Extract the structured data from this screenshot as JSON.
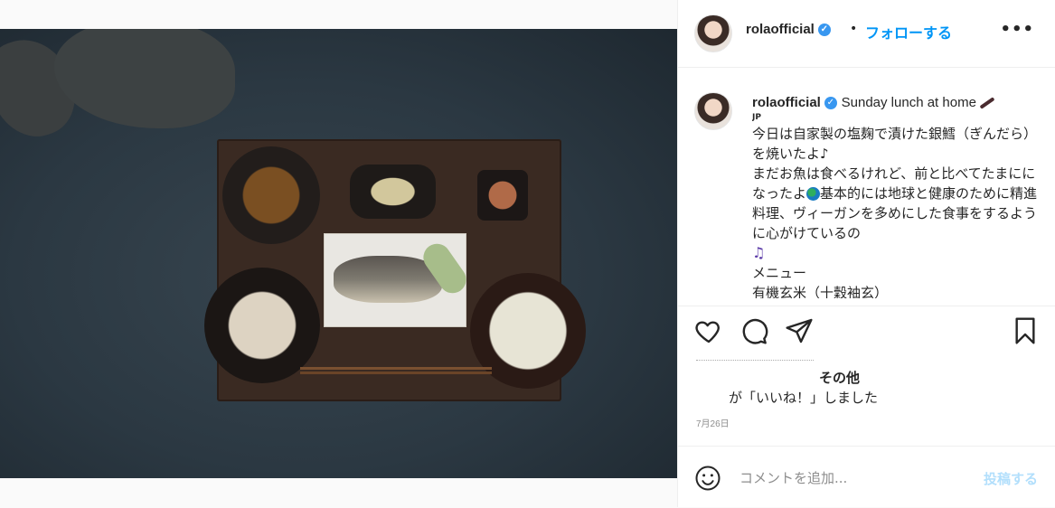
{
  "post": {
    "username": "rolaofficial",
    "separator": "•",
    "follow_label": "フォローする",
    "more_label": "•••"
  },
  "caption": {
    "username": "rolaofficial",
    "title": "Sunday lunch at home",
    "location_tag": "JP",
    "line1": "今日は自家製の塩麹で漬けた銀鱈（ぎんだら）を焼いたよ♪",
    "line2a": "まだお魚は食べるけれど、前と比べてたまにになったよ",
    "line2b": "基本的には地球と健康のために精進料理、ヴィーガンを多めにした食事をするように心がけているの",
    "line3": "メニュー",
    "line4": "有機玄米（十穀袖玄）"
  },
  "likes": {
    "others_label": "その他",
    "liked_text": "が「いいね！」しました"
  },
  "date": "7月26日",
  "comment": {
    "placeholder": "コメントを追加...",
    "post_label": "投稿する"
  },
  "colors": {
    "accent": "#0095f6",
    "verified": "#3897f0",
    "post_disabled": "#b2dffc"
  },
  "icons": [
    "heart-icon",
    "comment-icon",
    "share-icon",
    "bookmark-icon",
    "emoji-icon",
    "verified-badge-icon",
    "more-icon"
  ]
}
